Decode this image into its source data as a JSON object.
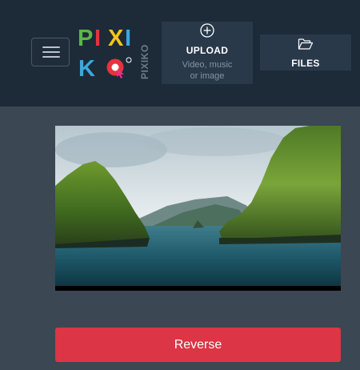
{
  "header": {
    "menu_icon": "hamburger-menu-icon",
    "logo": {
      "letters": [
        "P",
        "I",
        "X",
        "I",
        "K",
        "O"
      ],
      "vertical_text": "PIXIKO",
      "colors": {
        "green": "#5bb846",
        "red": "#e5343b",
        "yellow": "#f5c518",
        "blue": "#3aa9dc",
        "pink": "#e8308a"
      }
    },
    "upload": {
      "icon": "plus-circle-icon",
      "title": "UPLOAD",
      "subtitle_line1": "Video, music",
      "subtitle_line2": "or image"
    },
    "files": {
      "icon": "folder-open-icon",
      "title": "FILES"
    }
  },
  "main": {
    "video": {
      "description_icon": "video-preview"
    },
    "reverse_button": "Reverse"
  },
  "colors": {
    "header_bg": "#1d2a38",
    "page_bg": "#3b4753",
    "button_bg": "#29394a",
    "accent": "#dc3545"
  }
}
